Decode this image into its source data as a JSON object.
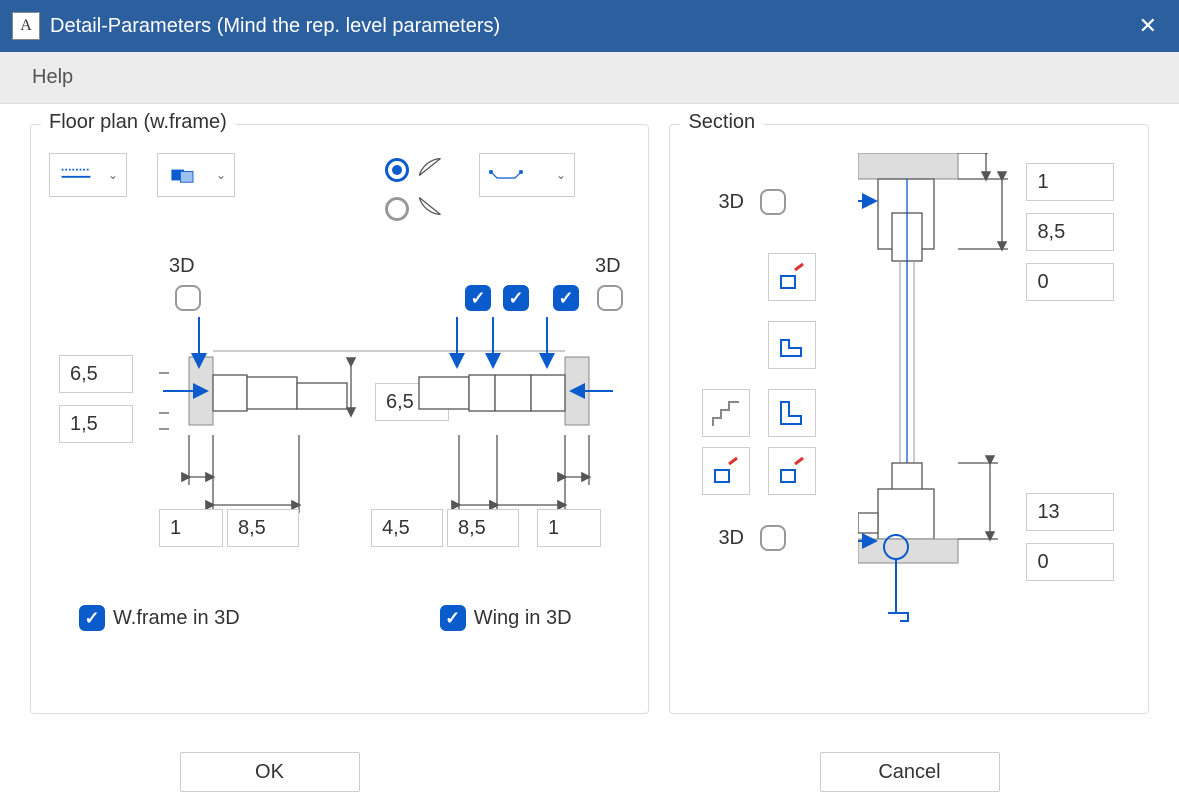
{
  "window": {
    "title": "Detail-Parameters (Mind the rep. level parameters)",
    "app_icon_letter": "A"
  },
  "menu": {
    "help": "Help"
  },
  "floorplan": {
    "title": "Floor plan (w.frame)",
    "label_3d_left": "3D",
    "label_3d_right": "3D",
    "param_left_top": "6,5",
    "param_left_bottom": "1,5",
    "param_center": "6,5",
    "bottom_1": "1",
    "bottom_2": "8,5",
    "bottom_3": "4,5",
    "bottom_4": "8,5",
    "bottom_5": "1",
    "check_wframe": "W.frame in 3D",
    "check_wing": "Wing in 3D"
  },
  "section": {
    "title": "Section",
    "label_3d_top": "3D",
    "label_3d_bottom": "3D",
    "param_r1": "1",
    "param_r2": "8,5",
    "param_r3": "0",
    "param_r4": "13",
    "param_r5": "0"
  },
  "buttons": {
    "ok": "OK",
    "cancel": "Cancel"
  },
  "icons": {
    "dropdown1": "line-style",
    "dropdown2": "overlap-rects",
    "dropdown3": "bracket",
    "tool1": "sill-edit",
    "tool2": "profile-step",
    "tool3": "stair-profile",
    "tool4": "profile-l",
    "tool5": "sill-edit-2",
    "tool6": "sill-edit-3"
  }
}
